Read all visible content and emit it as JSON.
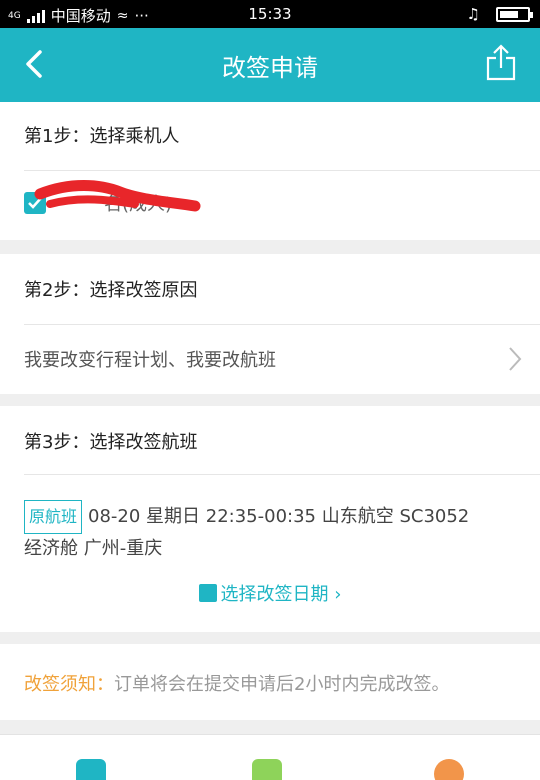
{
  "status_bar": {
    "network": "4G",
    "carrier": "中国移动",
    "more": "···",
    "time": "15:33",
    "battery_level": 0.7
  },
  "header": {
    "title": "改签申请"
  },
  "step1": {
    "title": "第1步：选择乘机人",
    "passenger_suffix": "名(成人)",
    "checked": true
  },
  "step2": {
    "title": "第2步：选择改签原因",
    "reason": "我要改变行程计划、我要改航班"
  },
  "step3": {
    "title": "第3步：选择改签航班",
    "original_tag": "原航班",
    "flight_info": "08-20 星期日  22:35-00:35  山东航空 SC3052",
    "cabin_route": "经济舱  广州-重庆",
    "select_date": "选择改签日期"
  },
  "notice": {
    "label": "改签须知：",
    "text": "订单将会在提交申请后2小时内完成改签。"
  },
  "colors": {
    "accent": "#1fb5c4",
    "notice": "#f0a23a",
    "green_tab": "#8ed35a",
    "orange_tab": "#f2954a"
  }
}
